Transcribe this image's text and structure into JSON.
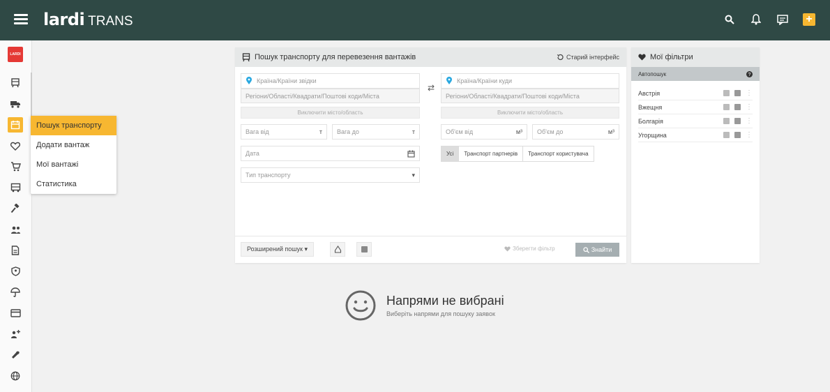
{
  "app": {
    "logo_main": "lardi",
    "logo_sub": "TRANS",
    "nav_logo_text": "LARDI"
  },
  "submenu": [
    {
      "label": "Пошук транспорту",
      "active": true
    },
    {
      "label": "Додати вантаж",
      "active": false
    },
    {
      "label": "Мої вантажі",
      "active": false
    },
    {
      "label": "Статистика",
      "active": false
    }
  ],
  "search": {
    "title": "Пошук транспорту для перевезення вантажів",
    "old_interface": "Старий інтерфейс",
    "from_placeholder": "Країна/Країни звідки",
    "to_placeholder": "Країна/Країни куди",
    "from_regions": "Регіони/Області/Квадрати/Поштові коди/Міста",
    "to_regions": "Регіони/Області/Квадрати/Поштові коди/Міста",
    "exclude_from": "Виключити місто/область",
    "exclude_to": "Виключити місто/область",
    "weight_from": "Вага від",
    "weight_to": "Вага до",
    "weight_unit": "т",
    "volume_from": "Об'єм від",
    "volume_to": "Об'єм до",
    "volume_unit": "м³",
    "date": "Дата",
    "transport_type": "Тип транспорту",
    "segments": [
      "Усі",
      "Транспорт партнерів",
      "Транспорт користувача"
    ],
    "advanced": "Розширений пошук",
    "save_filter": "Зберегти фільтр",
    "find": "Знайти"
  },
  "filters": {
    "title": "Мої фільтри",
    "autosearch": "Автопошук",
    "items": [
      "Австрія",
      "Вжещня",
      "Болгарія",
      "Угорщина"
    ]
  },
  "empty": {
    "title": "Напрями не вибрані",
    "subtitle": "Виберіть напрями для пошуку заявок"
  },
  "colors": {
    "topbar": "#2f4945",
    "accent": "#f7b731",
    "danger": "#e53935"
  }
}
